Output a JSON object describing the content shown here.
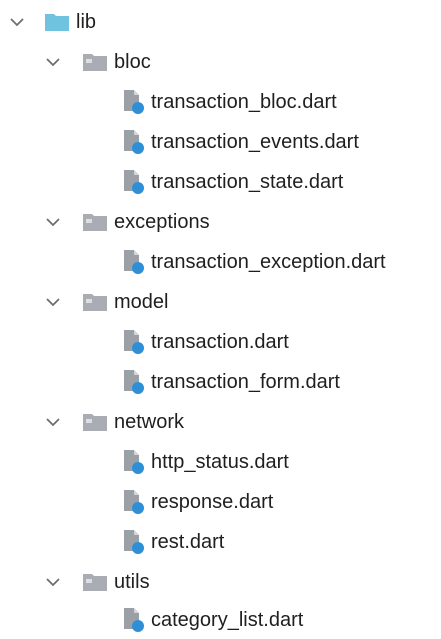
{
  "tree": {
    "root": {
      "label": "lib",
      "icon": "folder-blue-icon",
      "expanded": true
    },
    "folders": [
      {
        "label": "bloc",
        "icon": "folder-grey-icon",
        "expanded": true,
        "files": [
          {
            "label": "transaction_bloc.dart",
            "icon": "dart-file-icon"
          },
          {
            "label": "transaction_events.dart",
            "icon": "dart-file-icon"
          },
          {
            "label": "transaction_state.dart",
            "icon": "dart-file-icon"
          }
        ]
      },
      {
        "label": "exceptions",
        "icon": "folder-grey-icon",
        "expanded": true,
        "files": [
          {
            "label": "transaction_exception.dart",
            "icon": "dart-file-icon"
          }
        ]
      },
      {
        "label": "model",
        "icon": "folder-grey-icon",
        "expanded": true,
        "files": [
          {
            "label": "transaction.dart",
            "icon": "dart-file-icon"
          },
          {
            "label": "transaction_form.dart",
            "icon": "dart-file-icon"
          }
        ]
      },
      {
        "label": "network",
        "icon": "folder-grey-icon",
        "expanded": true,
        "files": [
          {
            "label": "http_status.dart",
            "icon": "dart-file-icon"
          },
          {
            "label": "response.dart",
            "icon": "dart-file-icon"
          },
          {
            "label": "rest.dart",
            "icon": "dart-file-icon"
          }
        ]
      },
      {
        "label": "utils",
        "icon": "folder-grey-icon",
        "expanded": true,
        "files": [
          {
            "label": "category_list.dart",
            "icon": "dart-file-icon"
          }
        ]
      }
    ],
    "colors": {
      "text": "#1f1f1f",
      "chevron": "#6e6e6e",
      "folder_root": "#6fc3df",
      "folder_sub": "#a9adb3",
      "file_grey": "#9aa0a6",
      "file_blue": "#2f8fd6"
    }
  }
}
